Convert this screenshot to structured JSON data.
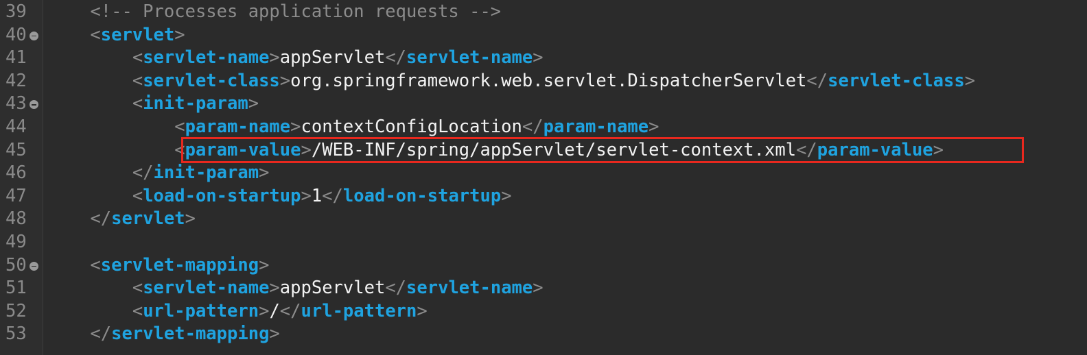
{
  "editor": {
    "lines": [
      {
        "no": "39",
        "fold": false,
        "indent": "    ",
        "tokens": [
          {
            "k": "c",
            "v": "<!-- Processes application requests -->"
          }
        ]
      },
      {
        "no": "40",
        "fold": true,
        "indent": "    ",
        "tokens": [
          {
            "k": "p",
            "v": "<"
          },
          {
            "k": "t",
            "v": "servlet"
          },
          {
            "k": "p",
            "v": ">"
          }
        ]
      },
      {
        "no": "41",
        "fold": false,
        "indent": "        ",
        "tokens": [
          {
            "k": "p",
            "v": "<"
          },
          {
            "k": "t",
            "v": "servlet-name"
          },
          {
            "k": "p",
            "v": ">"
          },
          {
            "k": "x",
            "v": "appServlet"
          },
          {
            "k": "p",
            "v": "</"
          },
          {
            "k": "t",
            "v": "servlet-name"
          },
          {
            "k": "p",
            "v": ">"
          }
        ]
      },
      {
        "no": "42",
        "fold": false,
        "indent": "        ",
        "tokens": [
          {
            "k": "p",
            "v": "<"
          },
          {
            "k": "t",
            "v": "servlet-class"
          },
          {
            "k": "p",
            "v": ">"
          },
          {
            "k": "x",
            "v": "org.springframework.web.servlet.DispatcherServlet"
          },
          {
            "k": "p",
            "v": "</"
          },
          {
            "k": "t",
            "v": "servlet-class"
          },
          {
            "k": "p",
            "v": ">"
          }
        ]
      },
      {
        "no": "43",
        "fold": true,
        "indent": "        ",
        "tokens": [
          {
            "k": "p",
            "v": "<"
          },
          {
            "k": "t",
            "v": "init-param"
          },
          {
            "k": "p",
            "v": ">"
          }
        ]
      },
      {
        "no": "44",
        "fold": false,
        "indent": "            ",
        "tokens": [
          {
            "k": "p",
            "v": "<"
          },
          {
            "k": "t",
            "v": "param-name"
          },
          {
            "k": "p",
            "v": ">"
          },
          {
            "k": "x",
            "v": "contextConfigLocation"
          },
          {
            "k": "p",
            "v": "</"
          },
          {
            "k": "t",
            "v": "param-name"
          },
          {
            "k": "p",
            "v": ">"
          }
        ]
      },
      {
        "no": "45",
        "fold": false,
        "indent": "            ",
        "tokens": [
          {
            "k": "p",
            "v": "<"
          },
          {
            "k": "t",
            "v": "param-value"
          },
          {
            "k": "p",
            "v": ">"
          },
          {
            "k": "x",
            "v": "/WEB-INF/spring/appServlet/servlet-context.xml"
          },
          {
            "k": "p",
            "v": "</"
          },
          {
            "k": "t",
            "v": "param-value"
          },
          {
            "k": "p",
            "v": ">"
          }
        ]
      },
      {
        "no": "46",
        "fold": false,
        "indent": "        ",
        "tokens": [
          {
            "k": "p",
            "v": "</"
          },
          {
            "k": "t",
            "v": "init-param"
          },
          {
            "k": "p",
            "v": ">"
          }
        ]
      },
      {
        "no": "47",
        "fold": false,
        "indent": "        ",
        "tokens": [
          {
            "k": "p",
            "v": "<"
          },
          {
            "k": "t",
            "v": "load-on-startup"
          },
          {
            "k": "p",
            "v": ">"
          },
          {
            "k": "x",
            "v": "1"
          },
          {
            "k": "p",
            "v": "</"
          },
          {
            "k": "t",
            "v": "load-on-startup"
          },
          {
            "k": "p",
            "v": ">"
          }
        ]
      },
      {
        "no": "48",
        "fold": false,
        "indent": "    ",
        "tokens": [
          {
            "k": "p",
            "v": "</"
          },
          {
            "k": "t",
            "v": "servlet"
          },
          {
            "k": "p",
            "v": ">"
          }
        ]
      },
      {
        "no": "49",
        "fold": false,
        "indent": "",
        "tokens": []
      },
      {
        "no": "50",
        "fold": true,
        "indent": "    ",
        "tokens": [
          {
            "k": "p",
            "v": "<"
          },
          {
            "k": "t",
            "v": "servlet-mapping"
          },
          {
            "k": "p",
            "v": ">"
          }
        ]
      },
      {
        "no": "51",
        "fold": false,
        "indent": "        ",
        "tokens": [
          {
            "k": "p",
            "v": "<"
          },
          {
            "k": "t",
            "v": "servlet-name"
          },
          {
            "k": "p",
            "v": ">"
          },
          {
            "k": "x",
            "v": "appServlet"
          },
          {
            "k": "p",
            "v": "</"
          },
          {
            "k": "t",
            "v": "servlet-name"
          },
          {
            "k": "p",
            "v": ">"
          }
        ]
      },
      {
        "no": "52",
        "fold": false,
        "indent": "        ",
        "tokens": [
          {
            "k": "p",
            "v": "<"
          },
          {
            "k": "t",
            "v": "url-pattern"
          },
          {
            "k": "p",
            "v": ">"
          },
          {
            "k": "x",
            "v": "/"
          },
          {
            "k": "p",
            "v": "</"
          },
          {
            "k": "t",
            "v": "url-pattern"
          },
          {
            "k": "p",
            "v": ">"
          }
        ]
      },
      {
        "no": "53",
        "fold": false,
        "indent": "    ",
        "tokens": [
          {
            "k": "p",
            "v": "</"
          },
          {
            "k": "t",
            "v": "servlet-mapping"
          },
          {
            "k": "p",
            "v": ">"
          }
        ]
      }
    ],
    "highlighted_line": "45",
    "highlight_color": "#e8281e"
  }
}
